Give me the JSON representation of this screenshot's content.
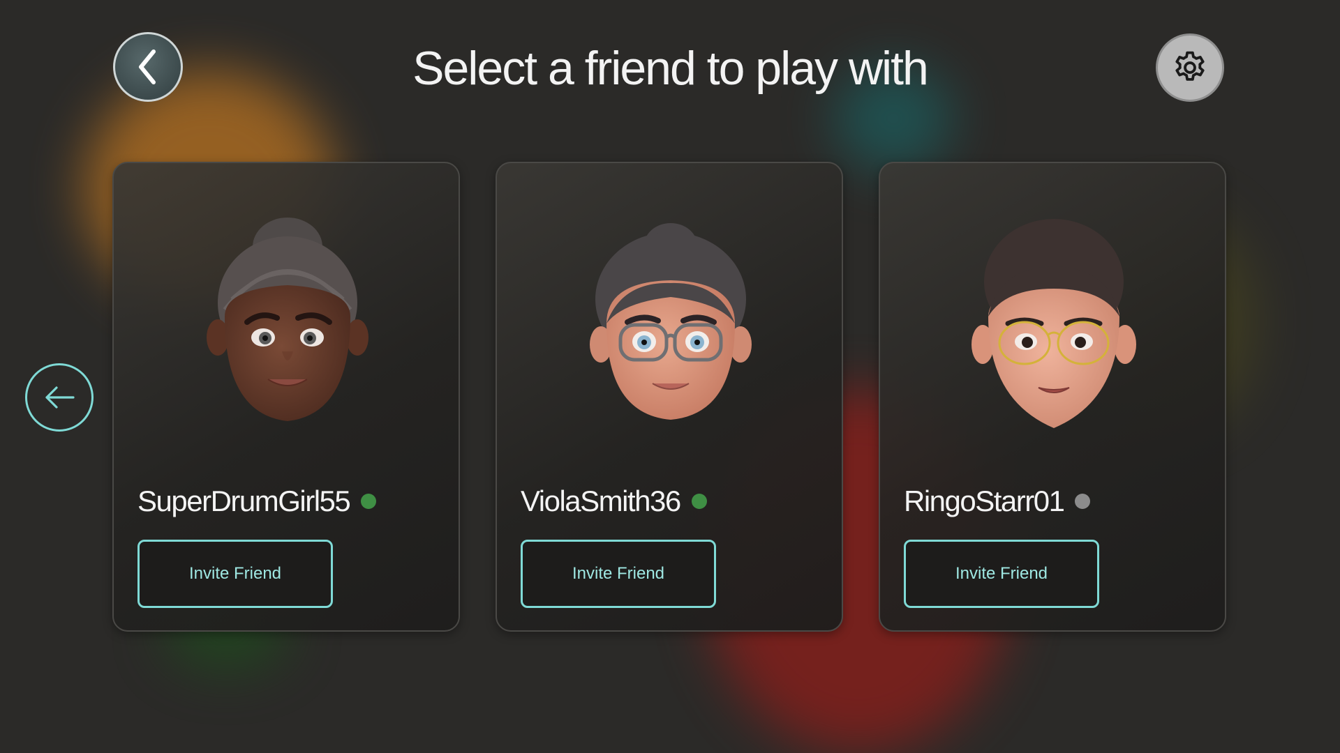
{
  "header": {
    "title": "Select a friend to play with",
    "back_icon": "chevron-left-icon",
    "settings_icon": "gear-icon"
  },
  "carousel": {
    "prev_icon": "arrow-left-icon"
  },
  "friends": [
    {
      "username": "SuperDrumGirl55",
      "status": "online",
      "status_color": "#3f8f44",
      "invite_label": "Invite Friend",
      "avatar": "avatar-curly-hair-bun"
    },
    {
      "username": "ViolaSmith36",
      "status": "online",
      "status_color": "#3f8f44",
      "invite_label": "Invite Friend",
      "avatar": "avatar-glasses-bun"
    },
    {
      "username": "RingoStarr01",
      "status": "offline",
      "status_color": "#8c8c8c",
      "invite_label": "Invite Friend",
      "avatar": "avatar-gold-glasses"
    }
  ],
  "colors": {
    "background": "#2b2a28",
    "accent": "#7fdad6",
    "online": "#3f8f44",
    "offline": "#8c8c8c"
  }
}
